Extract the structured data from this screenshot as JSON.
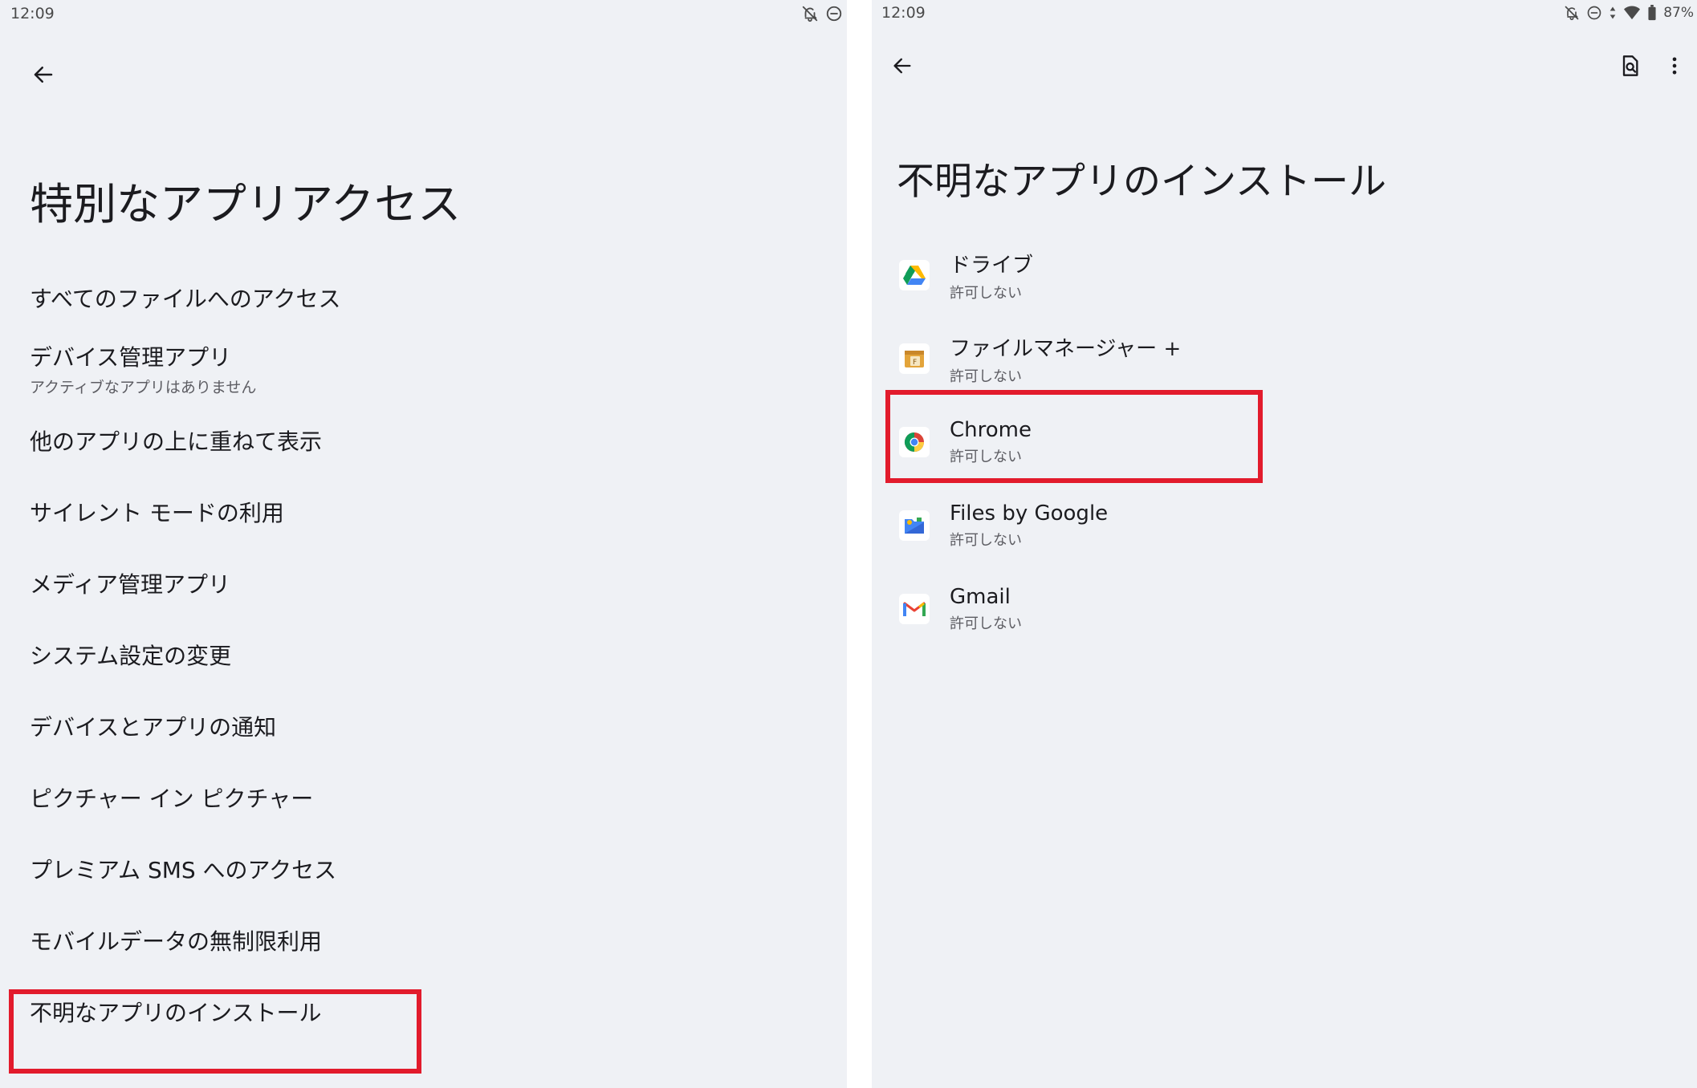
{
  "colors": {
    "background": "#eff1f5",
    "highlight": "#e21b2c",
    "primary_text": "#1b1b1f",
    "secondary_text": "#5d5d63"
  },
  "left_screen": {
    "status_bar": {
      "time": "12:09",
      "icons": [
        "notifications-off-icon",
        "do-not-disturb-icon"
      ]
    },
    "back_icon": "arrow-back-icon",
    "title": "特別なアプリアクセス",
    "items": [
      {
        "label": "すべてのファイルへのアクセス"
      },
      {
        "label": "デバイス管理アプリ",
        "subtitle": "アクティブなアプリはありません"
      },
      {
        "label": "他のアプリの上に重ねて表示"
      },
      {
        "label": "サイレント モードの利用"
      },
      {
        "label": "メディア管理アプリ"
      },
      {
        "label": "システム設定の変更"
      },
      {
        "label": "デバイスとアプリの通知"
      },
      {
        "label": "ピクチャー イン ピクチャー"
      },
      {
        "label": "プレミアム SMS へのアクセス"
      },
      {
        "label": "モバイルデータの無制限利用"
      },
      {
        "label": "不明なアプリのインストール",
        "highlighted": true
      }
    ]
  },
  "right_screen": {
    "status_bar": {
      "time": "12:09",
      "icons": [
        "notifications-off-icon",
        "do-not-disturb-icon",
        "data-arrows-icon",
        "wifi-icon",
        "battery-icon"
      ],
      "battery": "87%"
    },
    "back_icon": "arrow-back-icon",
    "toolbar_icons": [
      "search-in-page-icon",
      "more-vert-icon"
    ],
    "title": "不明なアプリのインストール",
    "apps": [
      {
        "name": "ドライブ",
        "status": "許可しない",
        "icon": "google-drive-icon"
      },
      {
        "name": "ファイルマネージャー +",
        "status": "許可しない",
        "icon": "file-manager-plus-icon"
      },
      {
        "name": "Chrome",
        "status": "許可しない",
        "icon": "chrome-icon",
        "highlighted": true
      },
      {
        "name": "Files by Google",
        "status": "許可しない",
        "icon": "files-by-google-icon"
      },
      {
        "name": "Gmail",
        "status": "許可しない",
        "icon": "gmail-icon"
      }
    ]
  }
}
